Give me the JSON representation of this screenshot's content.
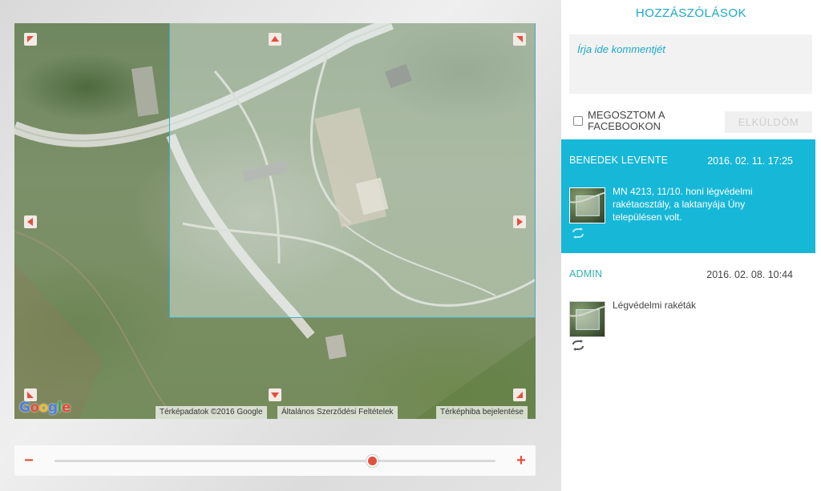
{
  "map": {
    "attribution": {
      "mapdata": "Térképadatok ©2016 Google",
      "terms": "Általános Szerződési Feltételek",
      "report": "Térképhiba bejelentése"
    },
    "logo_text": "Google",
    "zoom_level": 0.72
  },
  "panel": {
    "title": "HOZZÁSZÓLÁSOK",
    "comment_placeholder": "Írja ide kommentjét",
    "share_label": "MEGOSZTOM A FACEBOOKON",
    "send_label": "ELKÜLDÖM"
  },
  "comments": [
    {
      "author": "BENEDEK LEVENTE",
      "date": "2016. 02. 11. 17:25",
      "text": "MN 4213, 11/10. honi légvédelmi rakétaosztály, a laktanyája Úny településen volt.",
      "highlighted": true
    },
    {
      "author": "ADMIN",
      "date": "2016. 02. 08. 10:44",
      "text": "Légvédelmi rakéták",
      "highlighted": false
    }
  ],
  "colors": {
    "accent": "#1aa9c7",
    "highlight": "#17b7d8",
    "zoom": "#e2513b",
    "arrow": "#e2513b"
  },
  "icons": {
    "arrows": [
      "arrow-up-left-icon",
      "arrow-up-icon",
      "arrow-up-right-icon",
      "arrow-left-icon",
      "arrow-right-icon",
      "arrow-down-left-icon",
      "arrow-down-icon",
      "arrow-down-right-icon"
    ],
    "comment_action": "refresh-icon"
  }
}
